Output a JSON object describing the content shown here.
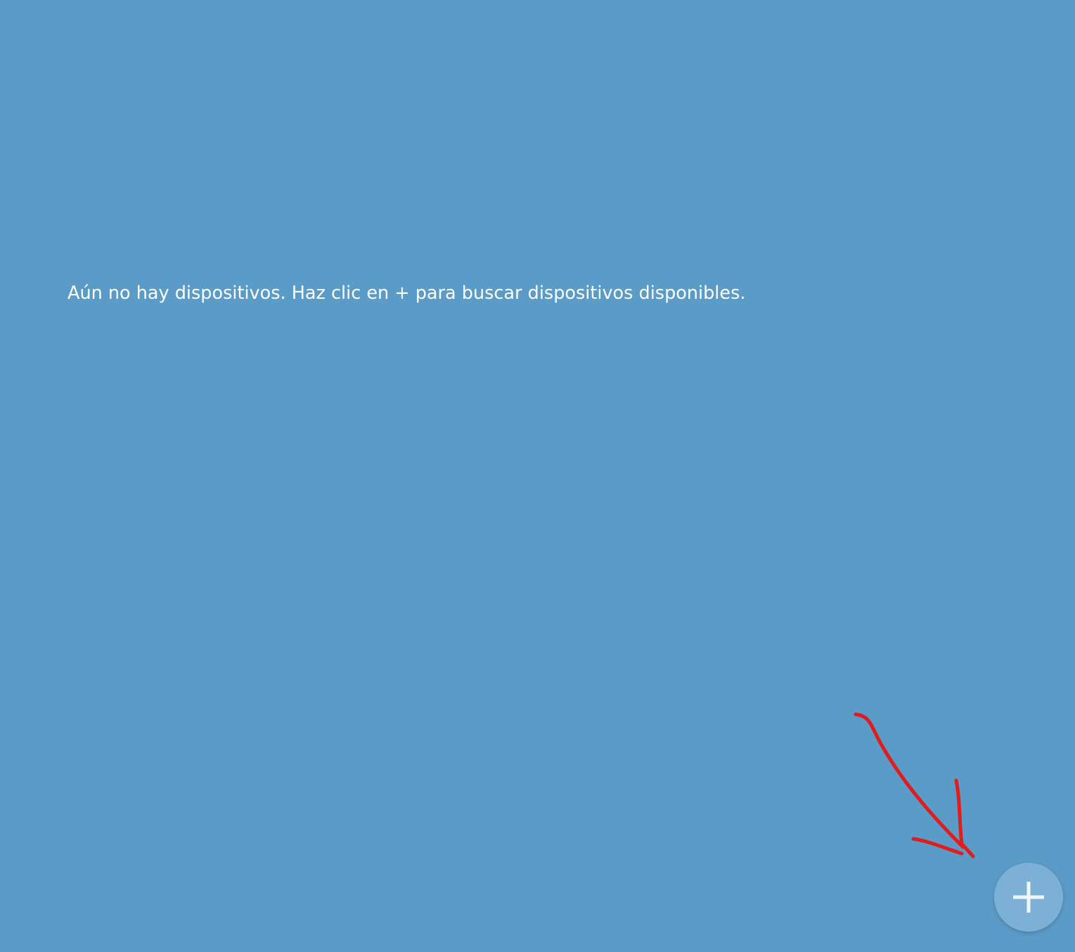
{
  "empty_state": {
    "message": "Aún no hay dispositivos. Haz clic en + para buscar dispositivos disponibles."
  },
  "add_device_button": {
    "icon": "plus-icon"
  },
  "colors": {
    "background": "#5b9bc7",
    "button": "#7db0d6",
    "annotation_arrow": "#e01c1c",
    "text": "#ffffff"
  }
}
